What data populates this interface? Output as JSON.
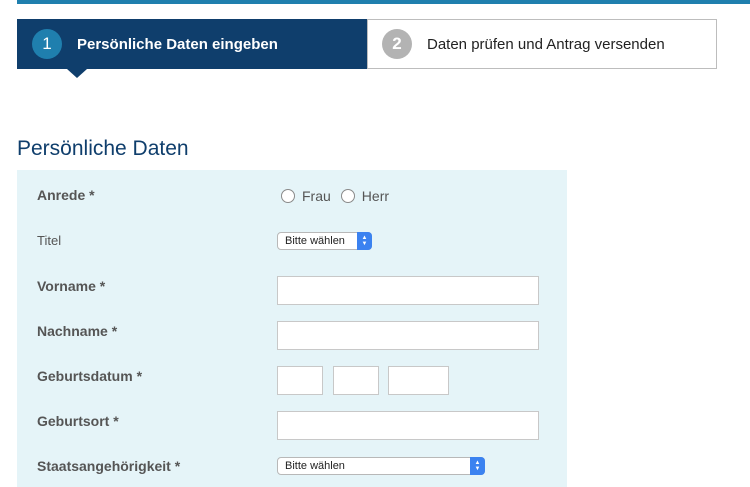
{
  "steps": [
    {
      "number": "1",
      "label": "Persönliche Daten eingeben"
    },
    {
      "number": "2",
      "label": "Daten prüfen und Antrag versenden"
    }
  ],
  "section": {
    "title": "Persönliche Daten"
  },
  "form": {
    "anrede": {
      "label": "Anrede *",
      "options": [
        "Frau",
        "Herr"
      ]
    },
    "titel": {
      "label": "Titel",
      "selected": "Bitte wählen"
    },
    "vorname": {
      "label": "Vorname *",
      "value": ""
    },
    "nachname": {
      "label": "Nachname *",
      "value": ""
    },
    "geburtsdatum": {
      "label": "Geburtsdatum *",
      "day": "",
      "month": "",
      "year": ""
    },
    "geburtsort": {
      "label": "Geburtsort *",
      "value": ""
    },
    "staatsangehoerigkeit": {
      "label": "Staatsangehörigkeit *",
      "selected": "Bitte wählen"
    }
  },
  "colors": {
    "active_step": "#0f3e6c",
    "accent": "#1f7fae",
    "panel": "#e5f4f8"
  }
}
